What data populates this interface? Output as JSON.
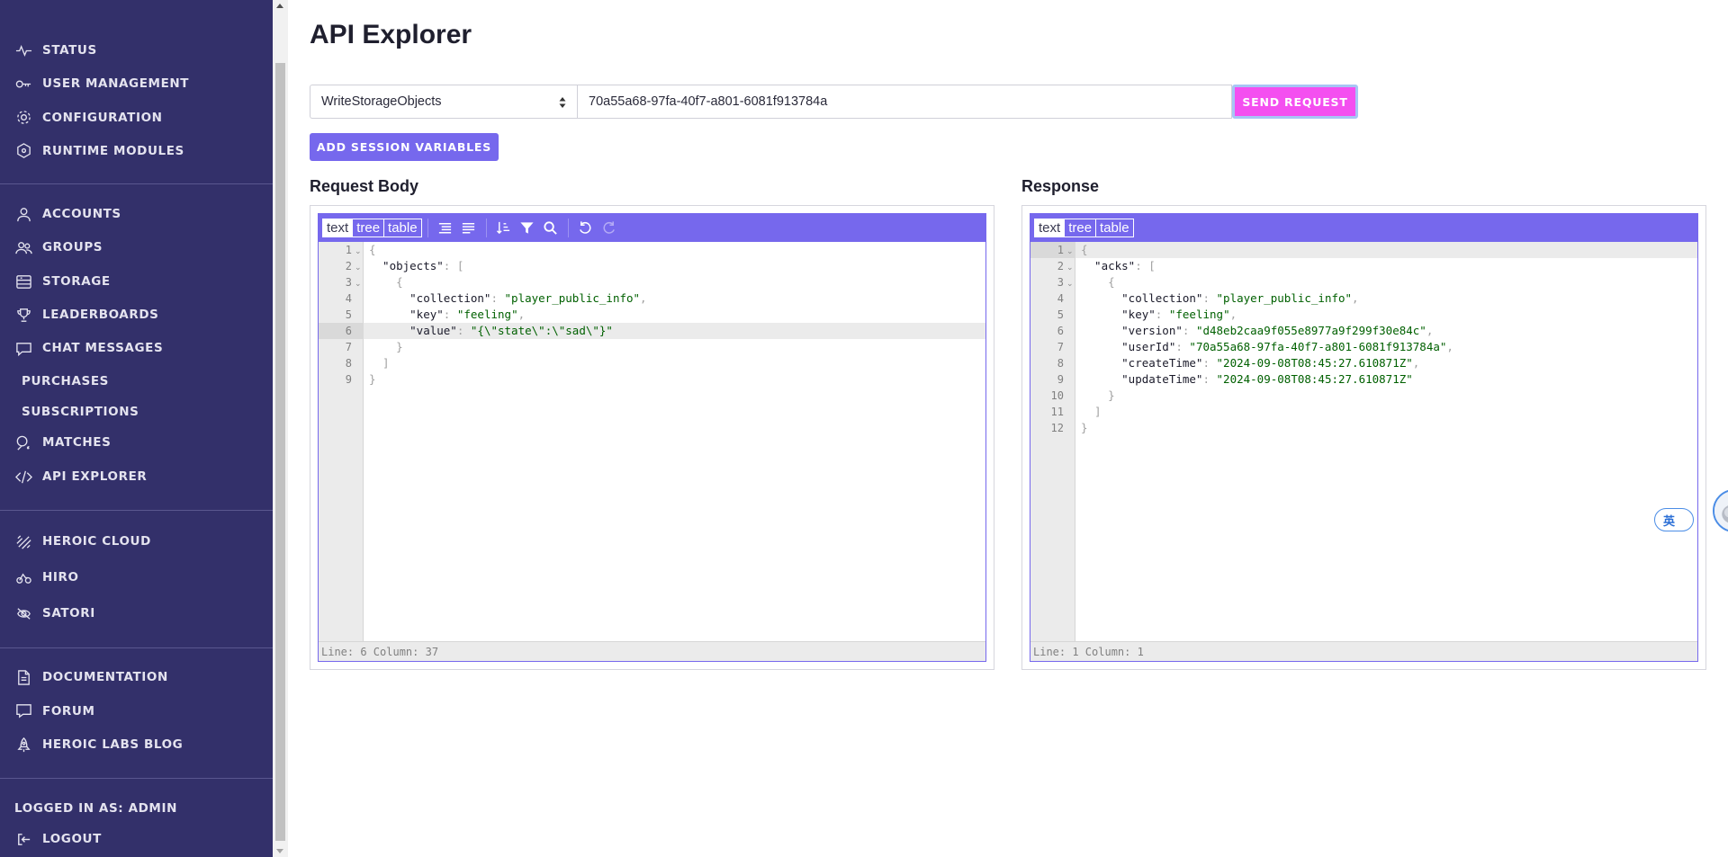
{
  "sidebar": {
    "group1": [
      {
        "label": "STATUS",
        "icon": "pulse-icon"
      },
      {
        "label": "USER MANAGEMENT",
        "icon": "key-icon"
      },
      {
        "label": "CONFIGURATION",
        "icon": "gear-icon"
      },
      {
        "label": "RUNTIME MODULES",
        "icon": "module-icon"
      }
    ],
    "group2": [
      {
        "label": "ACCOUNTS",
        "icon": "user-icon"
      },
      {
        "label": "GROUPS",
        "icon": "users-icon"
      },
      {
        "label": "STORAGE",
        "icon": "storage-icon"
      },
      {
        "label": "LEADERBOARDS",
        "icon": "trophy-icon"
      },
      {
        "label": "CHAT MESSAGES",
        "icon": "chat-icon"
      },
      {
        "label": "PURCHASES",
        "icon": ""
      },
      {
        "label": "SUBSCRIPTIONS",
        "icon": ""
      },
      {
        "label": "MATCHES",
        "icon": "matches-icon"
      },
      {
        "label": "API EXPLORER",
        "icon": "code-icon"
      }
    ],
    "group3": [
      {
        "label": "HEROIC CLOUD",
        "icon": "cloud-icon"
      },
      {
        "label": "HIRO",
        "icon": "hiro-icon"
      },
      {
        "label": "SATORI",
        "icon": "satori-icon"
      }
    ],
    "group4": [
      {
        "label": "DOCUMENTATION",
        "icon": "document-icon"
      },
      {
        "label": "FORUM",
        "icon": "forum-icon"
      },
      {
        "label": "HEROIC LABS BLOG",
        "icon": "rocket-icon"
      }
    ],
    "logged_in": "LOGGED IN AS: ADMIN",
    "logout": "LOGOUT"
  },
  "page": {
    "title": "API Explorer",
    "endpoint_select": "WriteStorageObjects",
    "user_id": "70a55a68-97fa-40f7-a801-6081f913784a",
    "send_label": "SEND REQUEST",
    "session_label": "ADD SESSION VARIABLES"
  },
  "request": {
    "title": "Request Body",
    "modes": [
      "text",
      "tree",
      "table"
    ],
    "active_mode": "text",
    "lines": [
      [
        [
          "p",
          "{"
        ]
      ],
      [
        [
          "k",
          "  \"objects\""
        ],
        [
          "p",
          ": ["
        ]
      ],
      [
        [
          "p",
          "    {"
        ]
      ],
      [
        [
          "k",
          "      \"collection\""
        ],
        [
          "p",
          ": "
        ],
        [
          "s",
          "\"player_public_info\""
        ],
        [
          "p",
          ","
        ]
      ],
      [
        [
          "k",
          "      \"key\""
        ],
        [
          "p",
          ": "
        ],
        [
          "s",
          "\"feeling\""
        ],
        [
          "p",
          ","
        ]
      ],
      [
        [
          "k",
          "      \"value\""
        ],
        [
          "p",
          ": "
        ],
        [
          "s",
          "\"{\\\"state\\\":\\\"sad\\\"}\""
        ]
      ],
      [
        [
          "p",
          "    }"
        ]
      ],
      [
        [
          "p",
          "  ]"
        ]
      ],
      [
        [
          "p",
          "}"
        ]
      ]
    ],
    "folds": [
      1,
      2,
      3
    ],
    "highlight_line": 6,
    "status": "Line: 6  Column: 37"
  },
  "response": {
    "title": "Response",
    "modes": [
      "text",
      "tree",
      "table"
    ],
    "active_mode": "text",
    "lines": [
      [
        [
          "p",
          "{"
        ]
      ],
      [
        [
          "k",
          "  \"acks\""
        ],
        [
          "p",
          ": ["
        ]
      ],
      [
        [
          "p",
          "    {"
        ]
      ],
      [
        [
          "k",
          "      \"collection\""
        ],
        [
          "p",
          ": "
        ],
        [
          "s",
          "\"player_public_info\""
        ],
        [
          "p",
          ","
        ]
      ],
      [
        [
          "k",
          "      \"key\""
        ],
        [
          "p",
          ": "
        ],
        [
          "s",
          "\"feeling\""
        ],
        [
          "p",
          ","
        ]
      ],
      [
        [
          "k",
          "      \"version\""
        ],
        [
          "p",
          ": "
        ],
        [
          "s",
          "\"d48eb2caa9f055e8977a9f299f30e84c\""
        ],
        [
          "p",
          ","
        ]
      ],
      [
        [
          "k",
          "      \"userId\""
        ],
        [
          "p",
          ": "
        ],
        [
          "s",
          "\"70a55a68-97fa-40f7-a801-6081f913784a\""
        ],
        [
          "p",
          ","
        ]
      ],
      [
        [
          "k",
          "      \"createTime\""
        ],
        [
          "p",
          ": "
        ],
        [
          "s",
          "\"2024-09-08T08:45:27.610871Z\""
        ],
        [
          "p",
          ","
        ]
      ],
      [
        [
          "k",
          "      \"updateTime\""
        ],
        [
          "p",
          ": "
        ],
        [
          "s",
          "\"2024-09-08T08:45:27.610871Z\""
        ]
      ],
      [
        [
          "p",
          "    }"
        ]
      ],
      [
        [
          "p",
          "  ]"
        ]
      ],
      [
        [
          "p",
          "}"
        ]
      ]
    ],
    "folds": [
      1,
      2,
      3
    ],
    "highlight_line": 1,
    "status": "Line: 1  Column: 1"
  },
  "widget": {
    "label": "英"
  },
  "colors": {
    "sidebar_bg": "#33306a",
    "accent": "#7668ed",
    "send_button": "#f44ff0",
    "string": "#006000"
  }
}
